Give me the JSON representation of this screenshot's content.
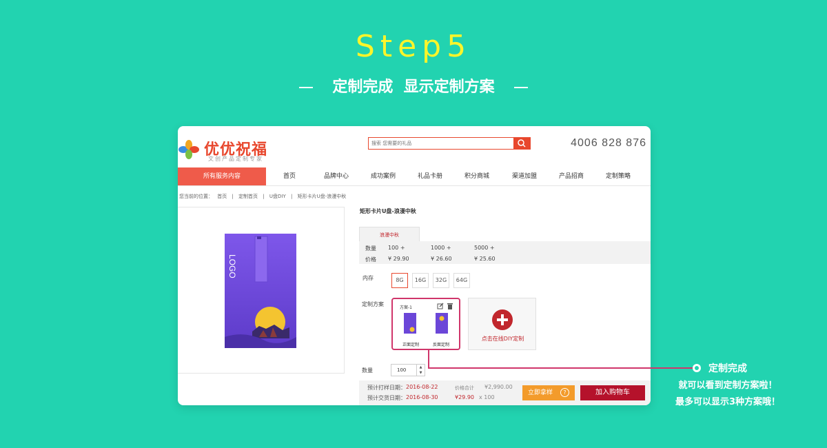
{
  "step": {
    "title": "Step5",
    "subtitle": "定制完成  显示定制方案"
  },
  "site": {
    "brand": "优优祝福",
    "tagline": "文创产品定制专家",
    "search_placeholder": "搜索 您需要的礼品",
    "phone": "4006 828 876"
  },
  "nav": {
    "all_services": "所有服务内容",
    "items": [
      "首页",
      "品牌中心",
      "成功案例",
      "礼品卡册",
      "积分商城",
      "渠道加盟",
      "产品招商",
      "定制策略"
    ]
  },
  "breadcrumb": {
    "prefix": "您当前的位置：",
    "items": [
      "首页",
      "定制首页",
      "U盘DIY",
      "矩形卡片U盘-浪漫中秋"
    ],
    "sep": "|"
  },
  "product": {
    "title": "矩形卡片U盘-浪漫中秋",
    "tab": "浪漫中秋",
    "card_logo": "LOGO",
    "price_table": {
      "qty_label": "数量",
      "price_label": "价格",
      "qtys": [
        "100 +",
        "1000 +",
        "5000 +"
      ],
      "prices": [
        "¥ 29.90",
        "¥ 26.60",
        "¥ 25.60"
      ]
    },
    "memory_label": "内存",
    "memory_options": [
      "8G",
      "16G",
      "32G",
      "64G"
    ],
    "memory_selected": "8G",
    "scheme_label": "定制方案",
    "scheme": {
      "name": "方案-1",
      "front": "正面定制",
      "back": "反面定制"
    },
    "diy_text": "点击在线DIY定制",
    "quantity_label": "数量",
    "quantity_value": "100",
    "sample_date_label": "预计打样日期：",
    "sample_date": "2016-08-22",
    "delivery_date_label": "预计交货日期：",
    "delivery_date": "2016-08-30",
    "total_label": "价格合计",
    "total": "¥2,990.00",
    "unit_price": "¥29.90",
    "times_qty": "x  100",
    "sample_button": "立即拿样",
    "cart_button": "加入购物车"
  },
  "callout": {
    "title": "定制完成",
    "line1": "就可以看到定制方案啦！",
    "line2": "最多可以显示3种方案哦！"
  },
  "colors": {
    "background": "#22d3b0",
    "step_title": "#fff52a",
    "accent_red": "#c1272d",
    "nav_red": "#ef5b4a",
    "scheme_border": "#d0356a",
    "card_purple": "#6b46d8"
  }
}
